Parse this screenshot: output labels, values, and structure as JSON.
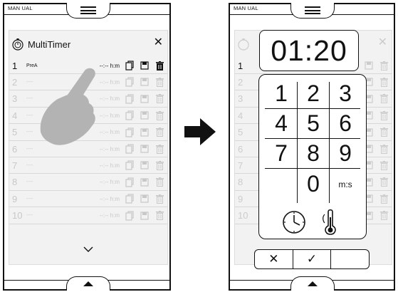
{
  "left": {
    "mode_label": "MAN UAL",
    "title": "MultiTimer",
    "rows": [
      {
        "num": "1",
        "name": "PreA",
        "time": "--:-- h:m"
      },
      {
        "num": "2",
        "name": "----",
        "time": "--:-- h:m"
      },
      {
        "num": "3",
        "name": "----",
        "time": "--:-- h:m"
      },
      {
        "num": "4",
        "name": "----",
        "time": "--:-- h:m"
      },
      {
        "num": "5",
        "name": "----",
        "time": "--:-- h:m"
      },
      {
        "num": "6",
        "name": "----",
        "time": "--:-- h:m"
      },
      {
        "num": "7",
        "name": "----",
        "time": "--:-- h:m"
      },
      {
        "num": "8",
        "name": "----",
        "time": "--:-- h:m"
      },
      {
        "num": "9",
        "name": "----",
        "time": "--:-- h:m"
      },
      {
        "num": "10",
        "name": "----",
        "time": "--:-- h:m"
      }
    ]
  },
  "right": {
    "mode_label": "MAN UAL",
    "time_display": "01:20",
    "keys": [
      "1",
      "2",
      "3",
      "4",
      "5",
      "6",
      "7",
      "8",
      "9",
      "0",
      "m:s"
    ],
    "bg_rows": [
      "1",
      "2",
      "3",
      "4",
      "5",
      "6",
      "7",
      "8",
      "9",
      "10"
    ]
  },
  "icons": {
    "menu": "hamburger-icon",
    "timer_logo": "stopwatch-icon",
    "close": "close-icon",
    "copy": "copy-icon",
    "save": "floppy-icon",
    "delete": "trash-icon",
    "scroll_down": "chevron-down-icon",
    "clock": "clock-icon",
    "probe": "core-probe-icon",
    "cancel": "x-icon",
    "confirm": "check-icon"
  }
}
